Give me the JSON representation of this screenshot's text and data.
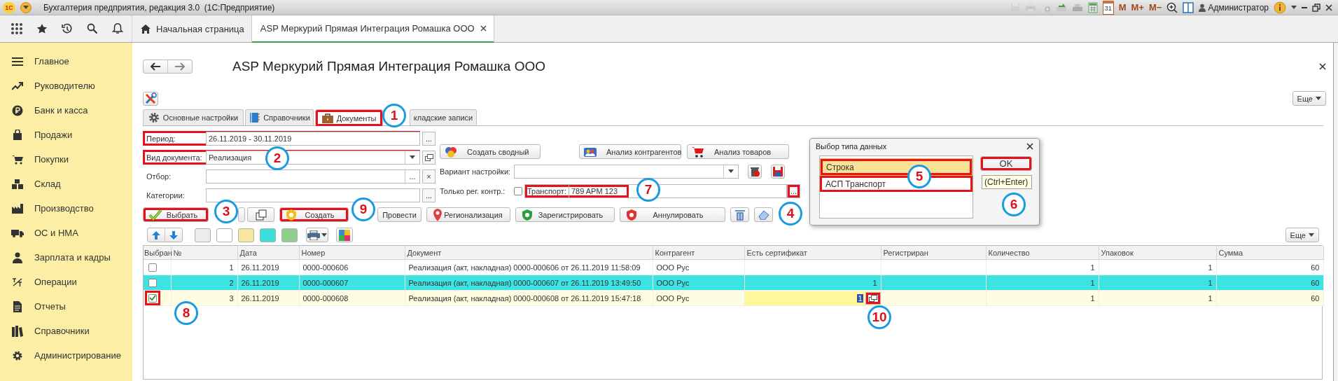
{
  "window": {
    "logo": "1С",
    "title": "Бухгалтерия предприятия, редакция 3.0  (1С:Предприятие)",
    "calendar_day": "31",
    "memory_buttons": [
      "M",
      "M+",
      "M−"
    ],
    "user": "Администратор"
  },
  "open_tabs": [
    {
      "kind": "home",
      "label": "Начальная страница",
      "selected": false
    },
    {
      "kind": "page",
      "label": "ASP Меркурий Прямая Интеграция Ромашка ООО",
      "selected": true
    }
  ],
  "sidebar": {
    "items": [
      "Главное",
      "Руководителю",
      "Банк и касса",
      "Продажи",
      "Покупки",
      "Склад",
      "Производство",
      "ОС и НМА",
      "Зарплата и кадры",
      "Операции",
      "Отчеты",
      "Справочники",
      "Администрирование"
    ]
  },
  "form": {
    "title": "ASP Меркурий Прямая Интеграция Ромашка ООО",
    "more_button": "Еще",
    "tabs": [
      {
        "kind": "settings",
        "label": "Основные настройки",
        "selected": false,
        "highlighted": false
      },
      {
        "kind": "directory",
        "label": "Справочники",
        "selected": false,
        "highlighted": false
      },
      {
        "kind": "documents",
        "label": "Документы",
        "selected": true,
        "highlighted": true
      },
      {
        "kind": "records",
        "label": "кладские записи",
        "selected": false,
        "highlighted": false
      }
    ],
    "fields": [
      {
        "kind": "choice",
        "label": "Период:",
        "value": "26.11.2019 - 30.11.2019",
        "button": "...",
        "highlighted": true
      },
      {
        "kind": "dropdown",
        "label": "Вид документа:",
        "value": "Реализация",
        "highlighted": true
      },
      {
        "kind": "clearable",
        "label": "Отбор:",
        "inner_button": "...",
        "button": "×",
        "highlighted": false
      },
      {
        "kind": "choice",
        "label": "Категории:",
        "button": "...",
        "highlighted": false
      }
    ],
    "summary_button": "Создать сводный",
    "analysis_buttons": [
      "Анализ контрагентов",
      "Анализ товаров"
    ],
    "variant": {
      "label": "Вариант настройки:"
    },
    "only_registered": {
      "label": "Только рег. контр.:",
      "checked": false
    },
    "transport": {
      "label": "Транспорт:",
      "value": "789 APM 123",
      "button": "...",
      "highlighted": true,
      "button_highlighted": true
    },
    "commands": [
      {
        "kind": "select",
        "label": "Выбрать",
        "highlighted": true
      },
      {
        "kind": "blank",
        "highlighted": false
      },
      {
        "kind": "copy",
        "highlighted": false
      },
      {
        "kind": "create",
        "label": "Создать",
        "highlighted": true
      },
      {
        "kind": "post",
        "label": "Провести",
        "highlighted": false
      },
      {
        "kind": "region",
        "label": "Регионализация",
        "highlighted": false
      },
      {
        "kind": "register",
        "label": "Зарегистрировать",
        "highlighted": false
      },
      {
        "kind": "annul",
        "label": "Аннулировать",
        "highlighted": false
      },
      {
        "kind": "trash",
        "highlighted": false
      },
      {
        "kind": "eraser",
        "highlighted": false
      }
    ],
    "toolbar": [
      {
        "kind": "up"
      },
      {
        "kind": "down"
      },
      {
        "kind": "swatch",
        "color": "#ececec"
      },
      {
        "kind": "swatch",
        "color": "#ffffff"
      },
      {
        "kind": "swatch",
        "color": "#f8e59e"
      },
      {
        "kind": "swatch",
        "color": "#3fdede"
      },
      {
        "kind": "swatch",
        "color": "#8fcf8c"
      },
      {
        "kind": "print"
      },
      {
        "kind": "palette"
      }
    ],
    "table_more_button": "Еще"
  },
  "table": {
    "columns": [
      "Выбран",
      "№",
      "Дата",
      "Номер",
      "Документ",
      "Контрагент",
      "Есть сертификат",
      "Регистриран",
      "Количество",
      "Упаковок",
      "Сумма"
    ],
    "rows": [
      {
        "color": "#ffffff",
        "checked": false,
        "highlighted": false,
        "number": "1",
        "date": "26.11.2019",
        "doc_number": "0000-000606",
        "document": "Реализация (акт, накладная) 0000-000606 от 26.11.2019 11:58:09",
        "counterparty": "ООО Рус",
        "editing": false,
        "quantity": "1",
        "packages": "1",
        "sum": "60"
      },
      {
        "color": "#3de3e3",
        "checked": false,
        "highlighted": false,
        "number": "2",
        "date": "26.11.2019",
        "doc_number": "0000-000607",
        "document": "Реализация (акт, накладная) 0000-000607 от 26.11.2019 13:49:50",
        "counterparty": "ООО Рус",
        "certificate": "1",
        "editing": false,
        "quantity": "1",
        "packages": "1",
        "sum": "60"
      },
      {
        "color": "#fdfde2",
        "checked": true,
        "highlighted": true,
        "number": "3",
        "date": "26.11.2019",
        "doc_number": "0000-000608",
        "document": "Реализация (акт, накладная) 0000-000608 от 26.11.2019 15:47:18",
        "counterparty": "ООО Рус",
        "certificate": "1",
        "editing": true,
        "quantity": "1",
        "packages": "1",
        "sum": "60"
      }
    ]
  },
  "dialog": {
    "title": "Выбор типа данных",
    "options": [
      {
        "label": "Строка",
        "selected": true,
        "highlighted": true
      },
      {
        "label": "АСП Транспорт",
        "selected": false,
        "highlighted": true
      }
    ],
    "ok_button": "OK",
    "ok_highlighted": true,
    "tooltip": "(Ctrl+Enter)"
  },
  "callouts": [
    "1",
    "2",
    "3",
    "4",
    "5",
    "6",
    "7",
    "8",
    "9",
    "10"
  ]
}
